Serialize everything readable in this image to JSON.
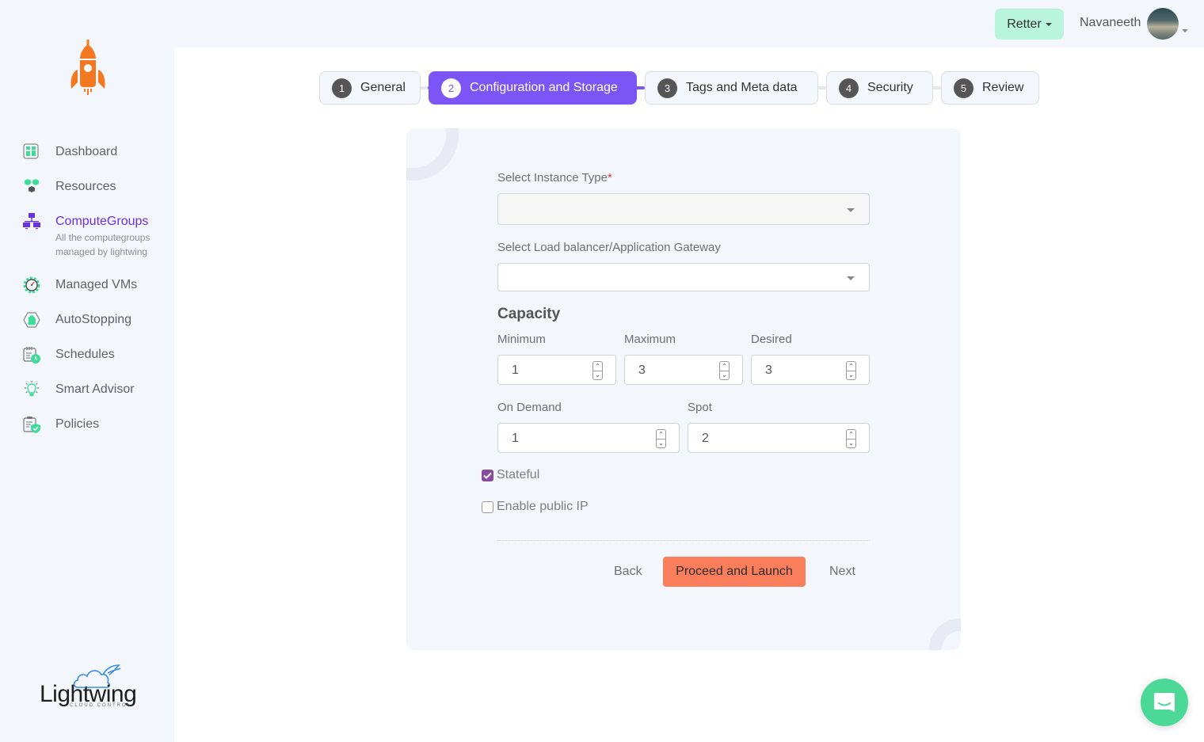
{
  "app": {
    "brand_name": "Lightwing",
    "brand_tagline": "CLOUD CONTROL"
  },
  "sidebar": {
    "items": [
      {
        "label": "Dashboard",
        "icon": "dashboard-icon"
      },
      {
        "label": "Resources",
        "icon": "resources-icon"
      },
      {
        "label": "ComputeGroups",
        "icon": "computegroups-icon",
        "active": true,
        "sublabel": "All the computegroups managed by lightwing"
      },
      {
        "label": "Managed VMs",
        "icon": "managed-vms-icon"
      },
      {
        "label": "AutoStopping",
        "icon": "autostopping-icon"
      },
      {
        "label": "Schedules",
        "icon": "schedules-icon"
      },
      {
        "label": "Smart Advisor",
        "icon": "smart-advisor-icon"
      },
      {
        "label": "Policies",
        "icon": "policies-icon"
      }
    ]
  },
  "header": {
    "account_label": "Retter",
    "username": "Navaneeth"
  },
  "stepper": {
    "steps": [
      {
        "num": "1",
        "label": "General"
      },
      {
        "num": "2",
        "label": "Configuration and Storage",
        "active": true
      },
      {
        "num": "3",
        "label": "Tags and Meta data"
      },
      {
        "num": "4",
        "label": "Security"
      },
      {
        "num": "5",
        "label": "Review"
      }
    ]
  },
  "form": {
    "instance_type": {
      "label": "Select Instance Type",
      "required_mark": "*",
      "value": ""
    },
    "load_balancer": {
      "label": "Select Load balancer/Application Gateway",
      "value": ""
    },
    "capacity_title": "Capacity",
    "minimum": {
      "label": "Minimum",
      "value": "1"
    },
    "maximum": {
      "label": "Maximum",
      "value": "3"
    },
    "desired": {
      "label": "Desired",
      "value": "3"
    },
    "on_demand": {
      "label": "On Demand",
      "value": "1"
    },
    "spot": {
      "label": "Spot",
      "value": "2"
    },
    "stateful": {
      "label": "Stateful",
      "checked": true
    },
    "public_ip": {
      "label": "Enable public IP",
      "checked": false
    },
    "back_label": "Back",
    "proceed_label": "Proceed and Launch",
    "next_label": "Next"
  },
  "colors": {
    "accent": "#7c55f7",
    "active_nav": "#6a2fe0",
    "primary_button": "#fa7d5c",
    "account_button": "#b9f5dc",
    "checkbox_checked": "#8a4b9e",
    "chat_button": "#4cd998",
    "logo_orange": "#f47820"
  }
}
